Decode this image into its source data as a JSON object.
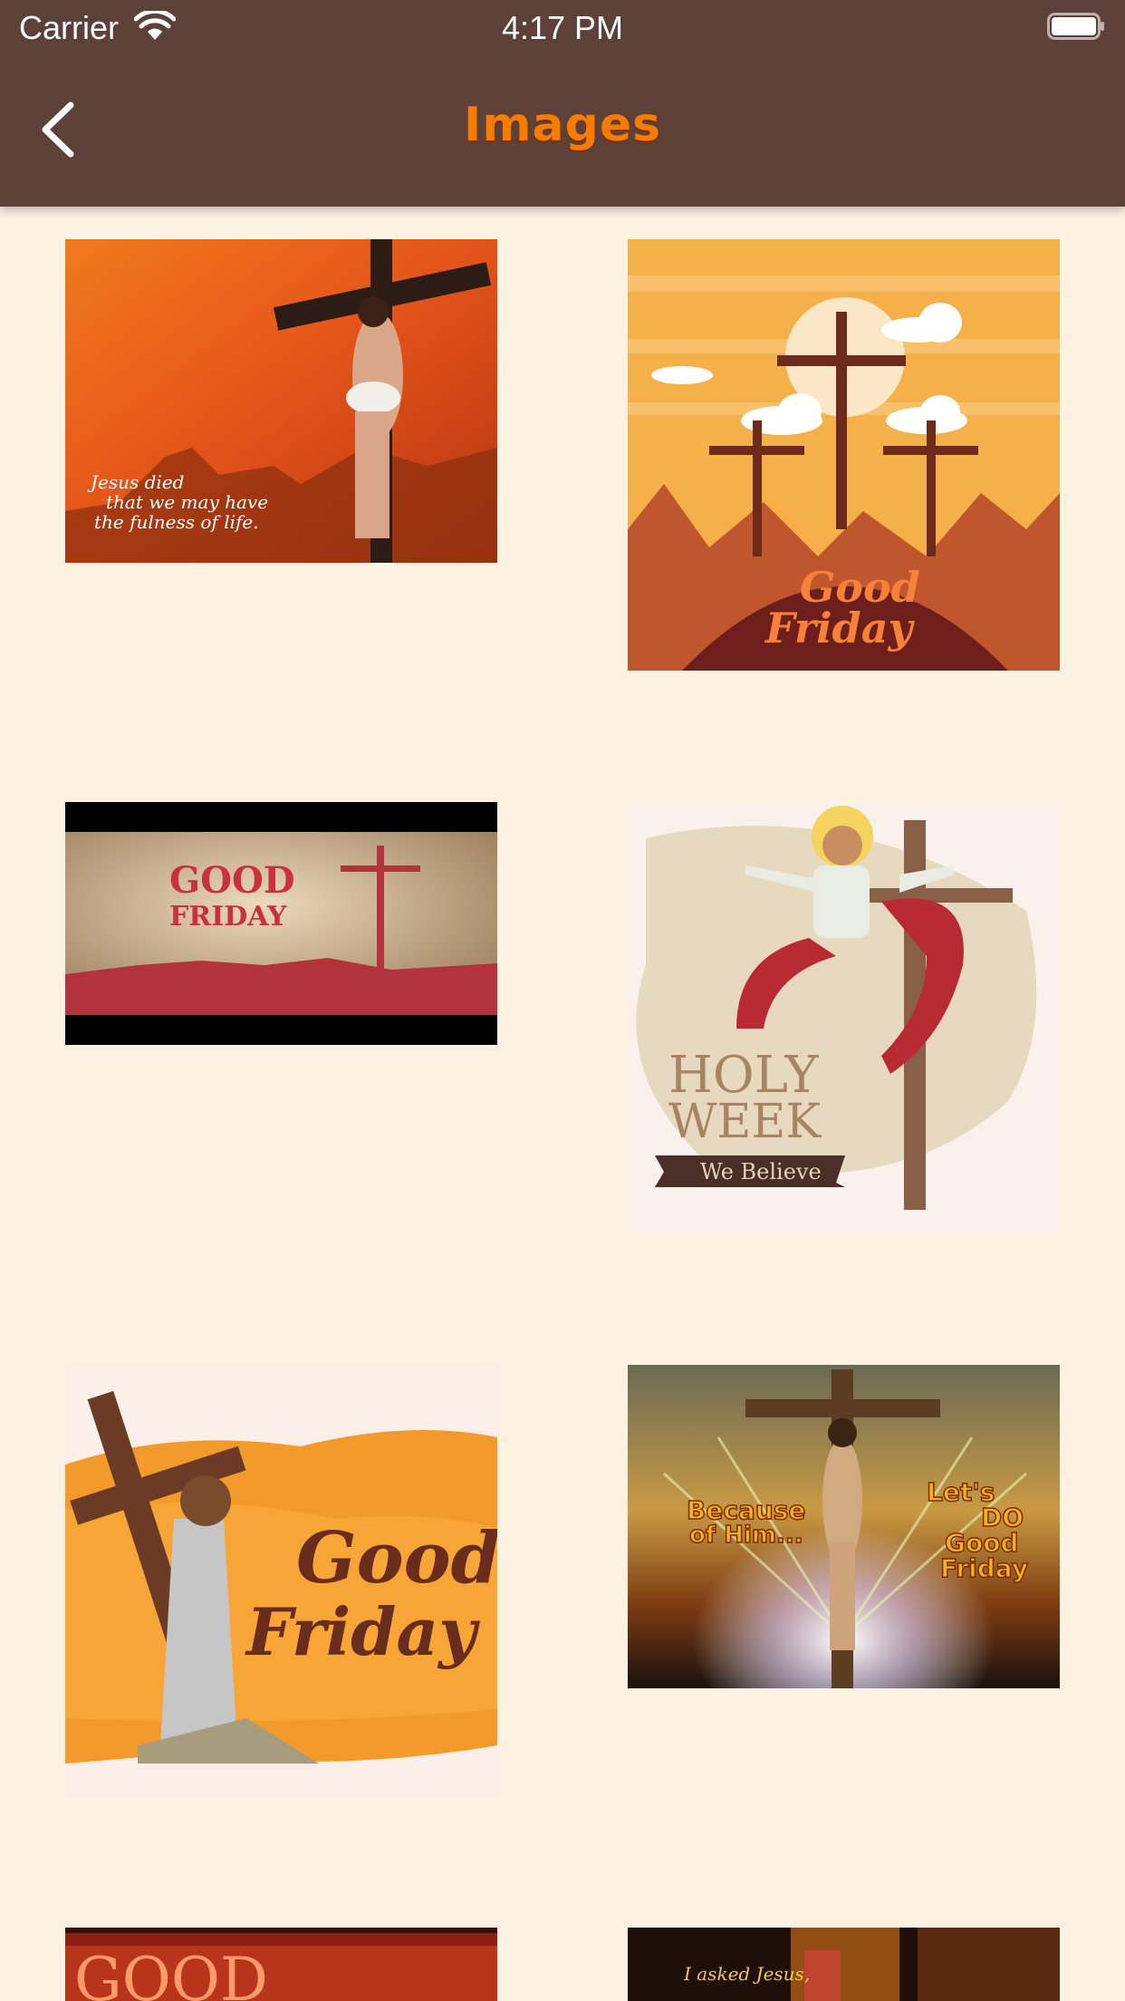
{
  "status_bar": {
    "carrier": "Carrier",
    "time": "4:17 PM"
  },
  "header": {
    "title": "Images"
  },
  "images": [
    {
      "caption_lines": [
        "Jesus died",
        "that we may have",
        "the fulness of life."
      ]
    },
    {
      "caption_lines": [
        "Good",
        "Friday"
      ]
    },
    {
      "caption_lines": [
        "GOOD",
        "FRIDAY"
      ]
    },
    {
      "caption_lines": [
        "HOLY",
        "WEEK",
        "We Believe"
      ]
    },
    {
      "caption_lines": [
        "Good",
        "Friday"
      ]
    },
    {
      "caption_lines": [
        "Because",
        "of Him...",
        "Let's",
        "DO",
        "Good",
        "Friday"
      ]
    },
    {
      "caption_lines": [
        "GOOD"
      ]
    },
    {
      "caption_lines": [
        "I asked Jesus,"
      ]
    }
  ],
  "colors": {
    "header_bg": "#5d4037",
    "title": "#f57c00",
    "page_bg": "#fdf1e2"
  }
}
